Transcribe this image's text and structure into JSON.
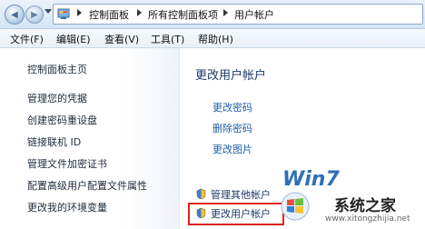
{
  "address_bar": {
    "breadcrumbs": [
      "控制面板",
      "所有控制面板项",
      "用户帐户"
    ]
  },
  "menu_bar": {
    "items": [
      "文件(F)",
      "编辑(E)",
      "查看(V)",
      "工具(T)",
      "帮助(H)"
    ]
  },
  "left_pane": {
    "links": [
      "控制面板主页",
      "管理您的凭据",
      "创建密码重设盘",
      "链接联机 ID",
      "管理文件加密证书",
      "配置高级用户配置文件属性",
      "更改我的环境变量"
    ]
  },
  "main": {
    "title": "更改用户帐户",
    "tasks": [
      "更改密码",
      "删除密码",
      "更改图片"
    ],
    "bottom_tasks": [
      "管理其他帐户",
      "更改用户帐户"
    ]
  },
  "watermark": {
    "brand": "Win7",
    "site_name": "系统之家",
    "url": "www.xitongzhijia.net"
  },
  "colors": {
    "link_blue": "#1e5fa8",
    "title_blue": "#1e3a6a",
    "highlight_red": "#e02020"
  }
}
